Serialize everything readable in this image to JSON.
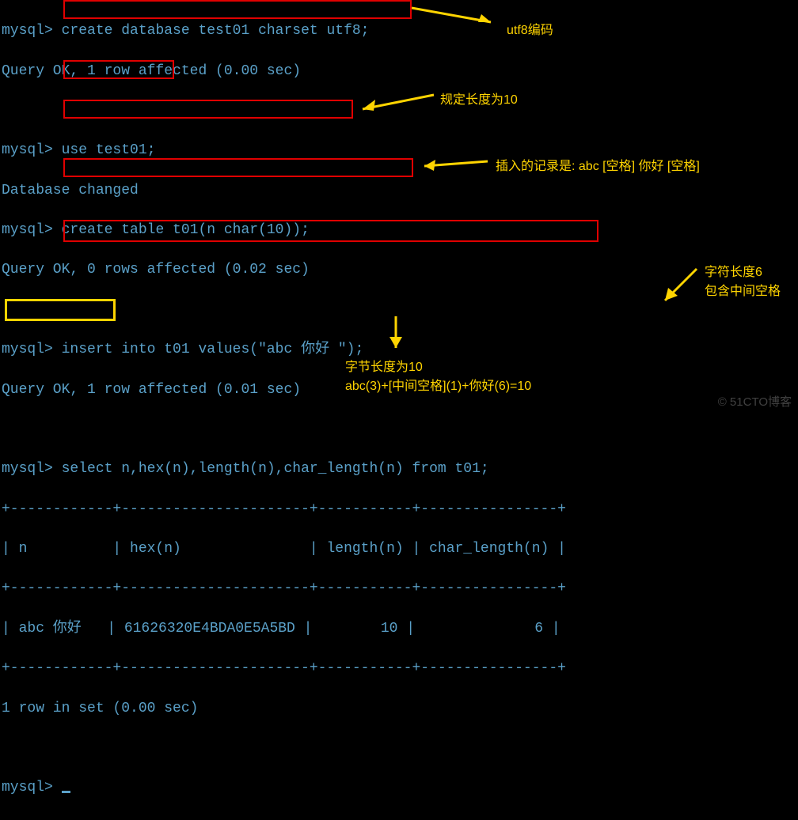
{
  "prompt": "mysql> ",
  "lines": {
    "cmd1": "create database test01 charset utf8;",
    "res1": "Query OK, 1 row affected (0.00 sec)",
    "cmd2": "use test01;",
    "res2": "Database changed",
    "cmd3": "create table t01(n char(10));",
    "res3": "Query OK, 0 rows affected (0.02 sec)",
    "cmd4": "insert into t01 values(\"abc 你好 \");",
    "res4": "Query OK, 1 row affected (0.01 sec)",
    "cmd5": "select n,hex(n),length(n),char_length(n) from t01;",
    "tblborder": "+------------+----------------------+-----------+----------------+",
    "header": "| n          | hex(n)               | length(n) | char_length(n) |",
    "row": "| abc 你好   | 61626320E4BDA0E5A5BD |        10 |              6 |",
    "rowcount": "1 row in set (0.00 sec)"
  },
  "annotations": {
    "a1": "utf8编码",
    "a2": "规定长度为10",
    "a3": "插入的记录是: abc [空格] 你好 [空格]",
    "a4_1": "字符长度6",
    "a4_2": "包含中间空格",
    "a5_1": "字节长度为10",
    "a5_2": "abc(3)+[中间空格](1)+你好(6)=10"
  },
  "watermark": "© 51CTO博客",
  "chart_data": {
    "type": "table",
    "columns": [
      "n",
      "hex(n)",
      "length(n)",
      "char_length(n)"
    ],
    "rows": [
      {
        "n": "abc 你好",
        "hex(n)": "61626320E4BDA0E5A5BD",
        "length(n)": 10,
        "char_length(n)": 6
      }
    ]
  }
}
